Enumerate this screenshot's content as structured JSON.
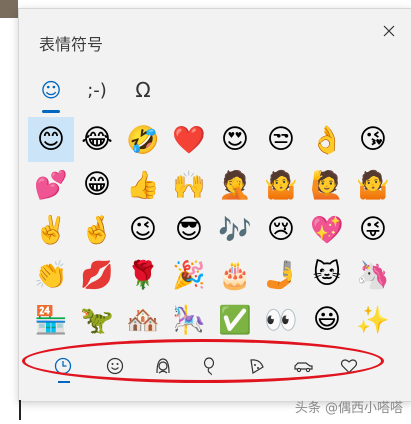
{
  "panel": {
    "title": "表情符号"
  },
  "tabs": [
    {
      "label": "☺",
      "name": "tab-emoji"
    },
    {
      "label": ";-)",
      "name": "tab-kaomoji"
    },
    {
      "label": "Ω",
      "name": "tab-symbols"
    }
  ],
  "emojis": [
    "😊",
    "😂",
    "🤣",
    "❤️",
    "😍",
    "😒",
    "👌",
    "😘",
    "",
    "💕",
    "😁",
    "👍",
    "🙌",
    "🤦",
    "🤷",
    "🙋",
    "🤷",
    "",
    "✌️",
    "🤞",
    "😉",
    "😎",
    "🎶",
    "😢",
    "💖",
    "😜",
    "",
    "👏",
    "💋",
    "🌹",
    "🎉",
    "🎂",
    "🤳",
    "🐱",
    "🦄",
    "",
    "🏪",
    "🦖",
    "🏘️",
    "🎠",
    "✅",
    "👀",
    "😃",
    "✨",
    ""
  ],
  "categories": [
    {
      "name": "recent-icon"
    },
    {
      "name": "smiley-icon"
    },
    {
      "name": "person-icon"
    },
    {
      "name": "balloon-icon"
    },
    {
      "name": "pizza-icon"
    },
    {
      "name": "car-icon"
    },
    {
      "name": "heart-icon"
    }
  ],
  "watermark": "头条 @偶西小嗒嗒",
  "colors": {
    "accent": "#0067c0",
    "annotation": "#e0141e"
  }
}
